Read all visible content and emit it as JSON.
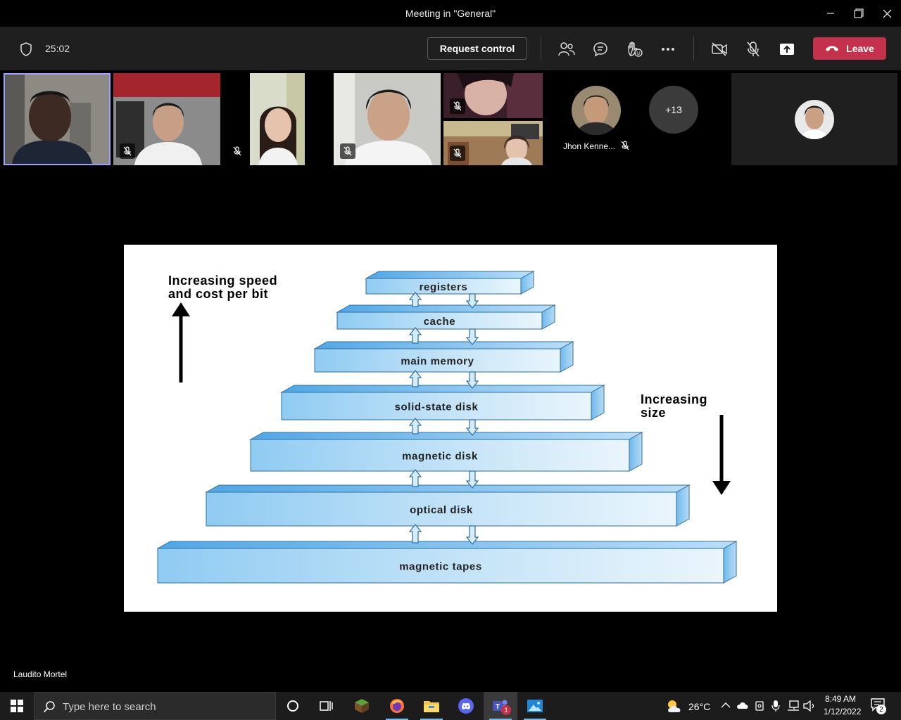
{
  "window": {
    "title": "Meeting in \"General\""
  },
  "toolbar": {
    "timer": "25:02",
    "request_control_label": "Request control",
    "leave_label": "Leave",
    "colors": {
      "leave": "#c4314b",
      "toolbar_bg": "#1f1f1f"
    }
  },
  "participants": {
    "named_tile_name": "Jhon Kenne...",
    "overflow_count": "+13",
    "presenter_name": "Laudito Mortel"
  },
  "slide": {
    "left_label_line1": "Increasing speed",
    "left_label_line2": "and cost per bit",
    "right_label_line1": "Increasing",
    "right_label_line2": "size",
    "levels": [
      "registers",
      "cache",
      "main memory",
      "solid-state disk",
      "magnetic disk",
      "optical disk",
      "magnetic tapes"
    ]
  },
  "taskbar": {
    "search_placeholder": "Type here to search",
    "weather": "26°C",
    "time": "8:49 AM",
    "date": "1/12/2022",
    "notification_count": "2",
    "teams_badge": "1"
  }
}
